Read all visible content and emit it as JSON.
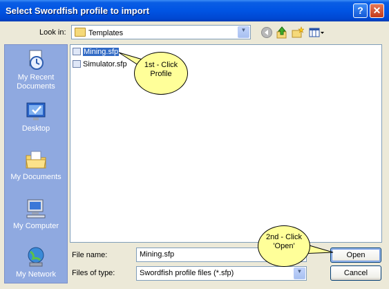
{
  "dialog": {
    "title": "Select Swordfish profile to import"
  },
  "titlebar": {
    "help_glyph": "?",
    "close_glyph": "✕"
  },
  "lookin": {
    "label": "Look in:",
    "value": "Templates",
    "icon": "folder-icon"
  },
  "toolbar": {
    "back": "back-icon",
    "up": "up-folder-icon",
    "new_folder": "new-folder-icon",
    "views": "views-menu-icon"
  },
  "places": [
    {
      "label": "My Recent Documents",
      "icon": "recent-documents-icon"
    },
    {
      "label": "Desktop",
      "icon": "desktop-icon"
    },
    {
      "label": "My Documents",
      "icon": "my-documents-icon"
    },
    {
      "label": "My Computer",
      "icon": "my-computer-icon"
    },
    {
      "label": "My Network",
      "icon": "my-network-icon"
    }
  ],
  "files": [
    {
      "name": "Mining.sfp",
      "selected": true
    },
    {
      "name": "Simulator.sfp",
      "selected": false
    }
  ],
  "filename": {
    "label": "File name:",
    "value": "Mining.sfp"
  },
  "filetype": {
    "label": "Files of type:",
    "value": "Swordfish profile files (*.sfp)"
  },
  "buttons": {
    "open": "Open",
    "cancel": "Cancel"
  },
  "callouts": {
    "first": {
      "line1": "1st - Click",
      "line2": "Profile"
    },
    "second": {
      "line1": "2nd - Click",
      "line2": "'Open'"
    }
  },
  "colors": {
    "titlebar": "#0054e3",
    "dialog_bg": "#ece9d8",
    "places_bg": "#8fa9e0",
    "selection": "#316ac5",
    "callout": "#ffff99"
  }
}
